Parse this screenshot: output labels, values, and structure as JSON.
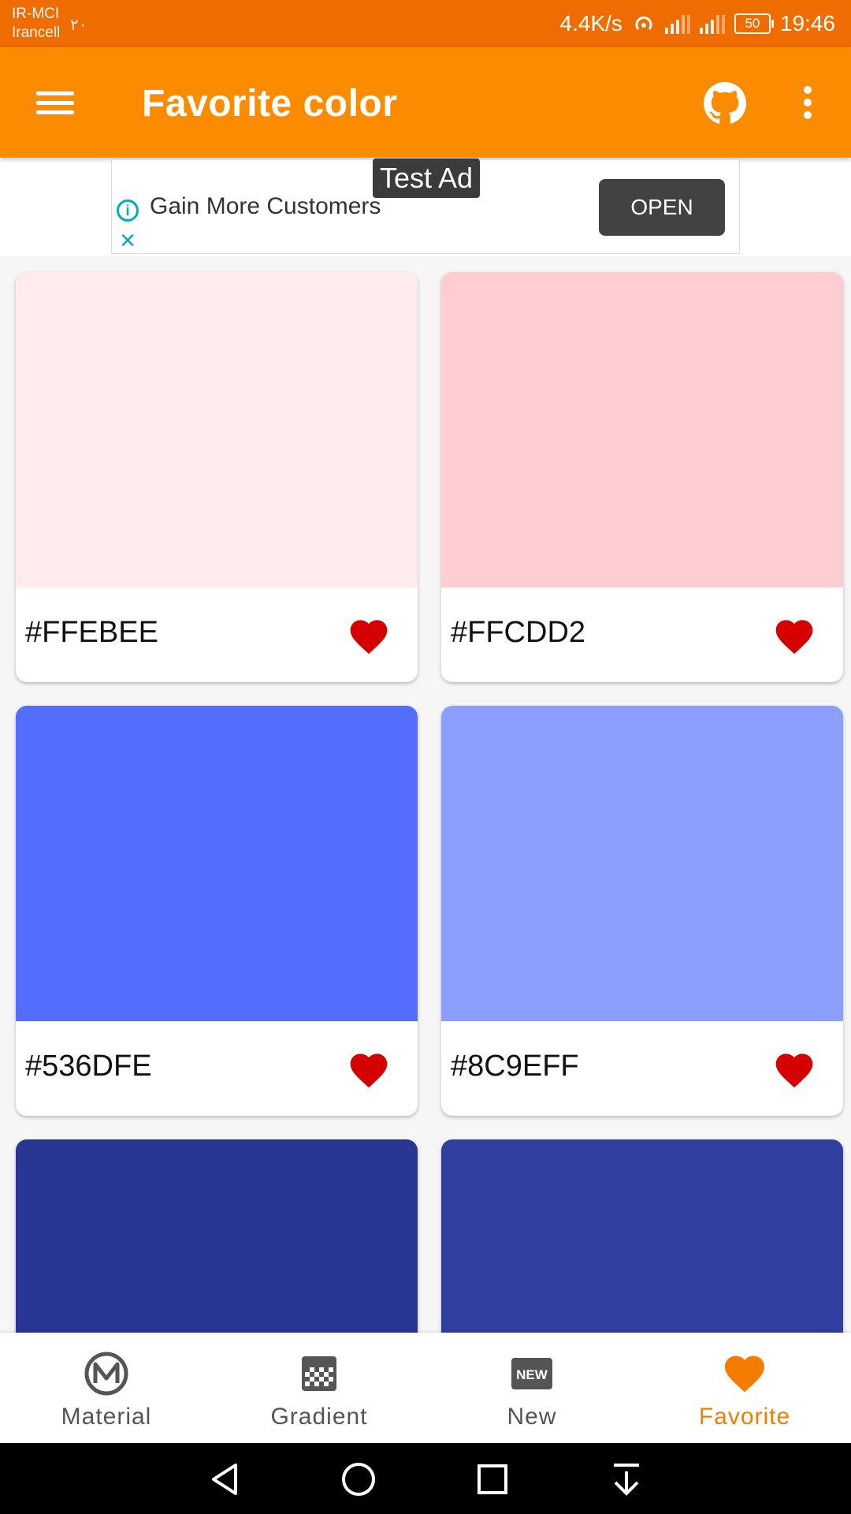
{
  "status_bar": {
    "carrier_line1": "IR-MCI",
    "carrier_line2": "Irancell",
    "carrier_extra": "۲۰",
    "net_speed": "4.4K/s",
    "battery": "50",
    "time": "19:46"
  },
  "app_bar": {
    "title": "Favorite color",
    "background": "#FB8C00"
  },
  "ad": {
    "label": "Test Ad",
    "headline": "Gain More Customers",
    "button": "OPEN"
  },
  "cards": [
    {
      "hex": "#FFEBEE",
      "color": "#FFEBEE",
      "favorited": true
    },
    {
      "hex": "#FFCDD2",
      "color": "#FFCDD2",
      "favorited": true
    },
    {
      "hex": "#536DFE",
      "color": "#536DFE",
      "favorited": true
    },
    {
      "hex": "#8C9EFF",
      "color": "#8C9EFF",
      "favorited": true
    },
    {
      "hex": "",
      "color": "#283593",
      "favorited": true
    },
    {
      "hex": "",
      "color": "#303F9F",
      "favorited": true
    }
  ],
  "bottom_nav": {
    "items": [
      {
        "label": "Material",
        "icon": "material-icon",
        "active": false
      },
      {
        "label": "Gradient",
        "icon": "gradient-icon",
        "active": false
      },
      {
        "label": "New",
        "icon": "new-icon",
        "active": false
      },
      {
        "label": "Favorite",
        "icon": "heart-icon",
        "active": true
      }
    ],
    "active_color": "#F57C00",
    "new_icon_text": "NEW"
  },
  "colors": {
    "status_bar": "#EF6C00",
    "heart": "#D50000"
  }
}
